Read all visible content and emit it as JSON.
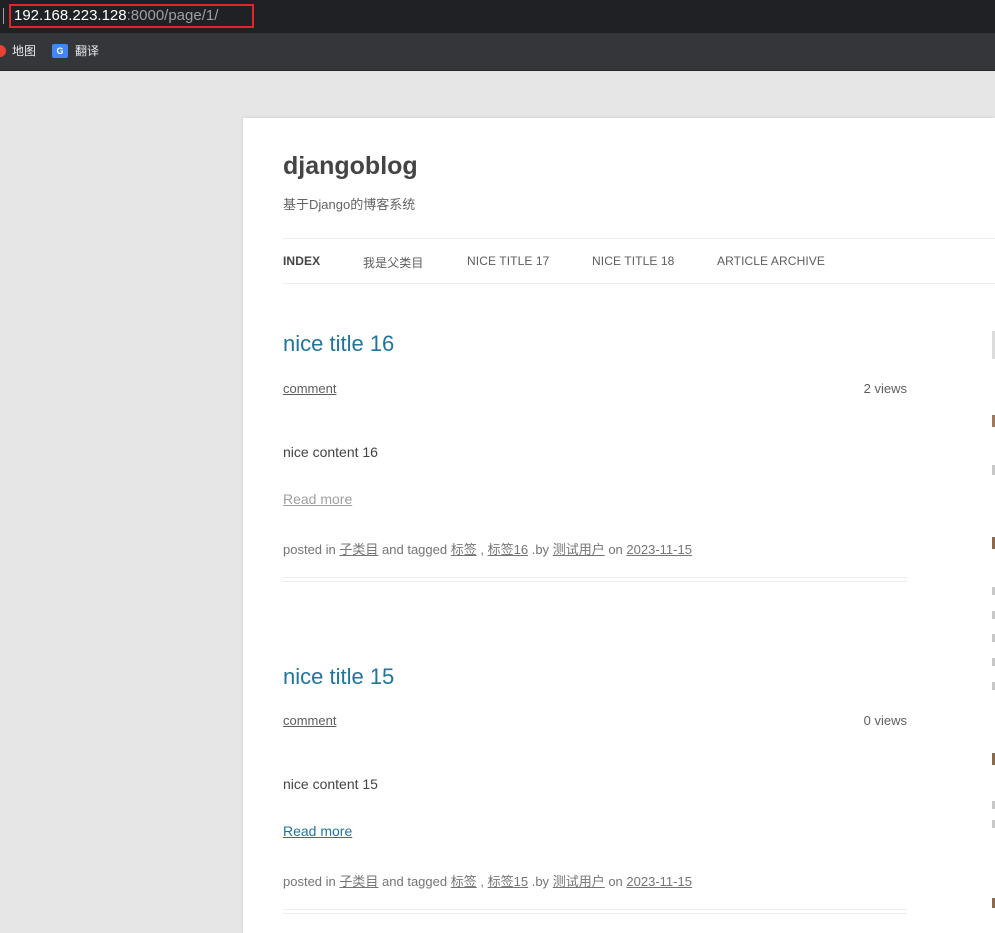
{
  "browser": {
    "address_host": "192.168.223.128",
    "address_path": ":8000/page/1/",
    "bookmarks": [
      {
        "label": "地图",
        "icon": "map-icon"
      },
      {
        "label": "翻译",
        "icon": "translate-icon"
      }
    ]
  },
  "site": {
    "title": "djangoblog",
    "description": "基于Django的博客系统"
  },
  "nav": [
    {
      "label": "INDEX",
      "active": true
    },
    {
      "label": "我是父类目",
      "active": false
    },
    {
      "label": "nice title 17",
      "active": false
    },
    {
      "label": "nice title 18",
      "active": false
    },
    {
      "label": "Article Archive",
      "active": false
    }
  ],
  "articles": [
    {
      "title": "nice title 16",
      "comment": "comment",
      "views": "2 views",
      "content": "nice content 16",
      "read_more": "Read more",
      "meta": {
        "posted_in": "posted in",
        "category": "子类目",
        "and_tagged": "and tagged",
        "tag1": "标签",
        "comma": ",",
        "tag2": "标签16",
        "by": ".by",
        "author": "测试用户",
        "on": "on",
        "date": "2023-11-15"
      }
    },
    {
      "title": "nice title 15",
      "comment": "comment",
      "views": "0 views",
      "content": "nice content 15",
      "read_more": "Read more",
      "meta": {
        "posted_in": "posted in",
        "category": "子类目",
        "and_tagged": "and tagged",
        "tag1": "标签",
        "comma": ",",
        "tag2": "标签15",
        "by": ".by",
        "author": "测试用户",
        "on": "on",
        "date": "2023-11-15"
      }
    }
  ],
  "colors": {
    "link": "#21759b",
    "text": "#444444",
    "muted": "#757575",
    "highlight_box": "#e0262b"
  }
}
